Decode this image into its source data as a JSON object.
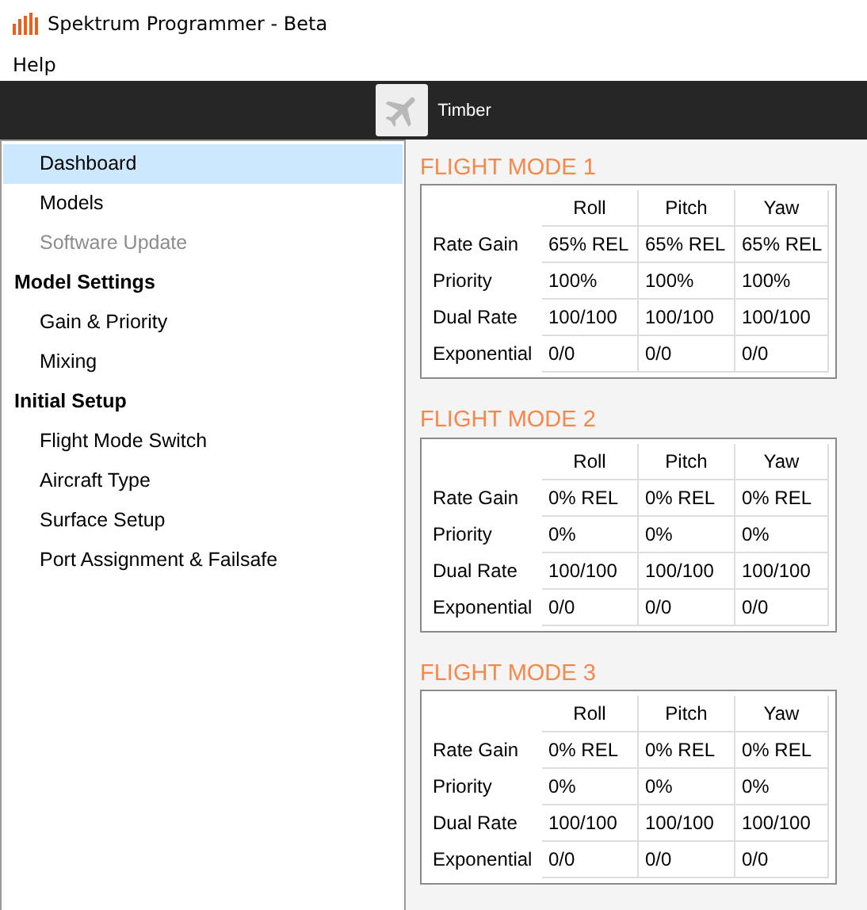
{
  "window": {
    "title": "Spektrum Programmer - Beta"
  },
  "menu": [
    {
      "label": "Help"
    }
  ],
  "model_bar": {
    "name": "Timber"
  },
  "sidebar": {
    "items": [
      {
        "kind": "link",
        "label": "Dashboard",
        "selected": true,
        "disabled": false
      },
      {
        "kind": "link",
        "label": "Models",
        "selected": false,
        "disabled": false
      },
      {
        "kind": "link",
        "label": "Software Update",
        "selected": false,
        "disabled": true
      },
      {
        "kind": "heading",
        "label": "Model Settings",
        "children": [
          {
            "kind": "link",
            "label": "Gain & Priority",
            "selected": false,
            "disabled": false
          },
          {
            "kind": "link",
            "label": "Mixing",
            "selected": false,
            "disabled": false
          }
        ]
      },
      {
        "kind": "heading",
        "label": "Initial Setup",
        "children": [
          {
            "kind": "link",
            "label": "Flight Mode Switch",
            "selected": false,
            "disabled": false
          },
          {
            "kind": "link",
            "label": "Aircraft Type",
            "selected": false,
            "disabled": false
          },
          {
            "kind": "link",
            "label": "Surface Setup",
            "selected": false,
            "disabled": false
          },
          {
            "kind": "link",
            "label": "Port Assignment & Failsafe",
            "selected": false,
            "disabled": false
          }
        ]
      }
    ]
  },
  "flight_modes": [
    {
      "title": "FLIGHT MODE 1",
      "columns": [
        "Roll",
        "Pitch",
        "Yaw"
      ],
      "rows": [
        {
          "label": "Rate Gain",
          "values": [
            "65% REL",
            "65% REL",
            "65% REL"
          ]
        },
        {
          "label": "Priority",
          "values": [
            "100%",
            "100%",
            "100%"
          ]
        },
        {
          "label": "Dual Rate",
          "values": [
            "100/100",
            "100/100",
            "100/100"
          ]
        },
        {
          "label": "Exponential",
          "values": [
            "0/0",
            "0/0",
            "0/0"
          ]
        }
      ]
    },
    {
      "title": "FLIGHT MODE 2",
      "columns": [
        "Roll",
        "Pitch",
        "Yaw"
      ],
      "rows": [
        {
          "label": "Rate Gain",
          "values": [
            "0% REL",
            "0% REL",
            "0% REL"
          ]
        },
        {
          "label": "Priority",
          "values": [
            "0%",
            "0%",
            "0%"
          ]
        },
        {
          "label": "Dual Rate",
          "values": [
            "100/100",
            "100/100",
            "100/100"
          ]
        },
        {
          "label": "Exponential",
          "values": [
            "0/0",
            "0/0",
            "0/0"
          ]
        }
      ]
    },
    {
      "title": "FLIGHT MODE 3",
      "columns": [
        "Roll",
        "Pitch",
        "Yaw"
      ],
      "rows": [
        {
          "label": "Rate Gain",
          "values": [
            "0% REL",
            "0% REL",
            "0% REL"
          ]
        },
        {
          "label": "Priority",
          "values": [
            "0%",
            "0%",
            "0%"
          ]
        },
        {
          "label": "Dual Rate",
          "values": [
            "100/100",
            "100/100",
            "100/100"
          ]
        },
        {
          "label": "Exponential",
          "values": [
            "0/0",
            "0/0",
            "0/0"
          ]
        }
      ]
    }
  ]
}
